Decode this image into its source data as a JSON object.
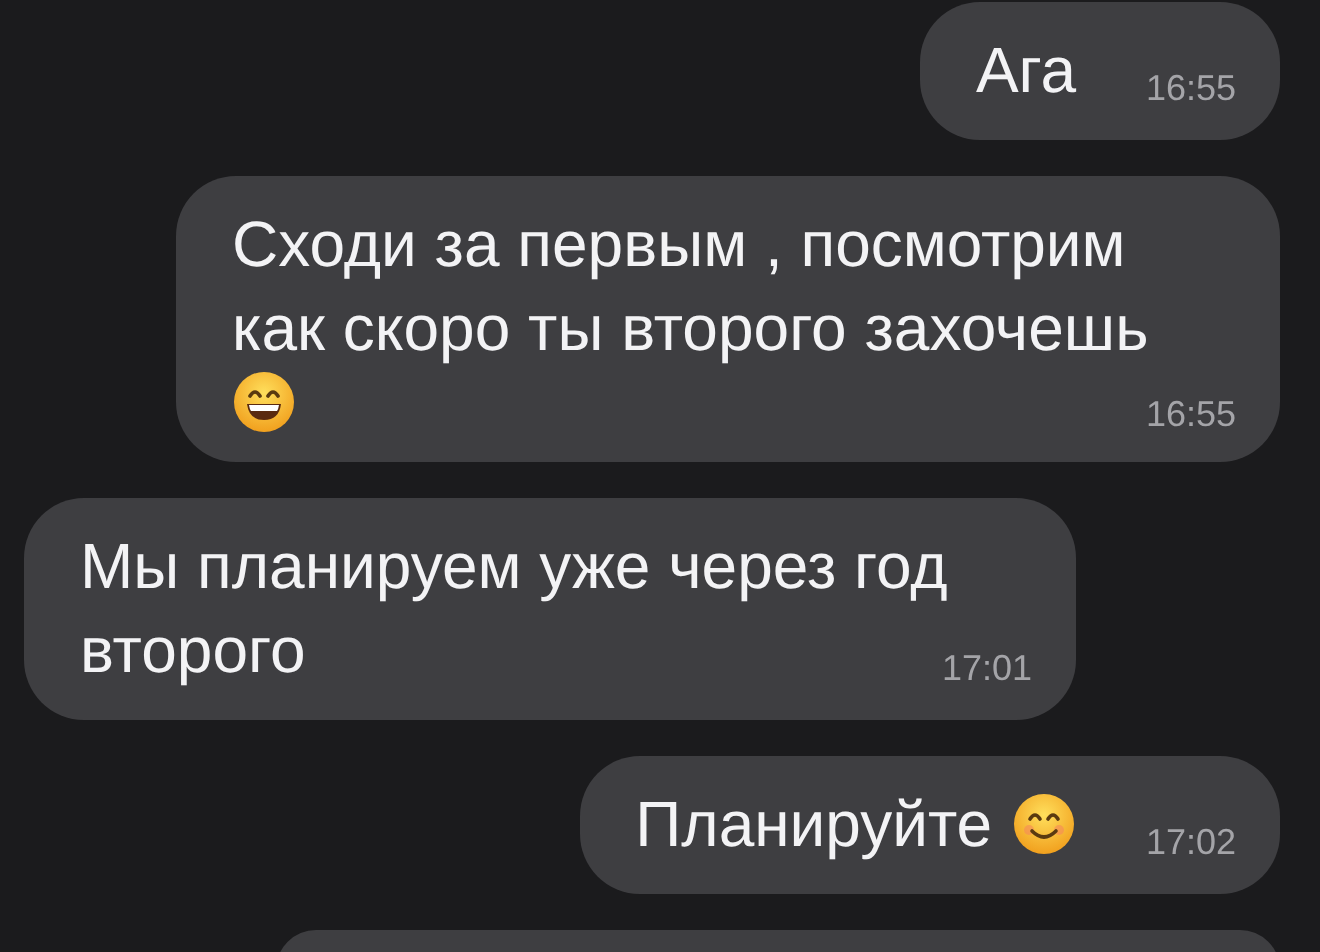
{
  "messages": [
    {
      "kind": "outgoing",
      "text": "Ага",
      "time": "16:55"
    },
    {
      "kind": "outgoing",
      "text": "Сходи за первым , посмотрим как скоро ты второго захочешь",
      "emoji": {
        "kind": "grin",
        "own_line": true
      },
      "time": "16:55"
    },
    {
      "kind": "incoming",
      "text": "Мы планируем уже через год второго",
      "time": "17:01"
    },
    {
      "kind": "outgoing",
      "text": "Планируйте",
      "emoji": {
        "kind": "smile",
        "own_line": false
      },
      "time": "17:02"
    }
  ]
}
